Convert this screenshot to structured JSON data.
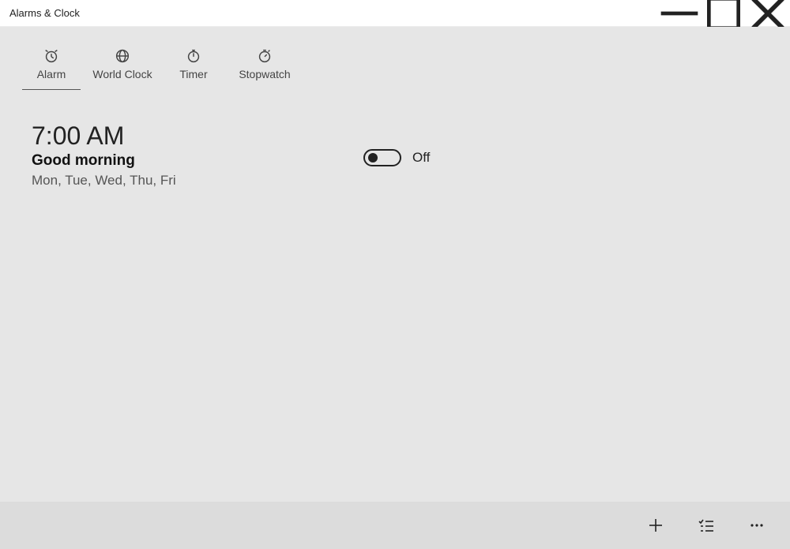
{
  "titlebar": {
    "title": "Alarms & Clock"
  },
  "tabs": [
    {
      "label": "Alarm",
      "active": true
    },
    {
      "label": "World Clock",
      "active": false
    },
    {
      "label": "Timer",
      "active": false
    },
    {
      "label": "Stopwatch",
      "active": false
    }
  ],
  "alarm": {
    "time": "7:00 AM",
    "name": "Good morning",
    "days": "Mon, Tue, Wed, Thu, Fri",
    "toggle_state": "Off"
  }
}
